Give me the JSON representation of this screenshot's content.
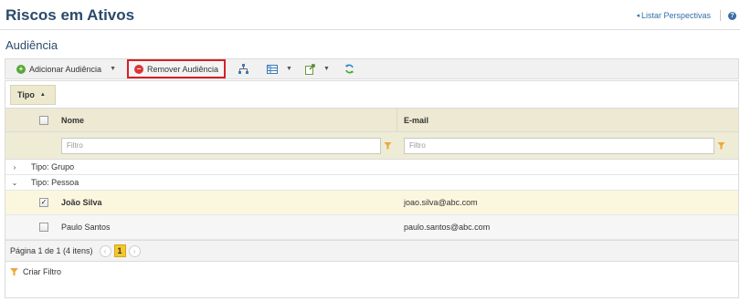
{
  "page": {
    "title": "Riscos em Ativos"
  },
  "top_links": {
    "list_perspectives": "Listar Perspectivas",
    "help_icon": "?"
  },
  "section": {
    "title": "Audiência"
  },
  "toolbar": {
    "add_label": "Adicionar Audiência",
    "remove_label": "Remover Audiência",
    "icons": [
      "hierarchy-icon",
      "columns-icon",
      "export-icon",
      "refresh-icon"
    ]
  },
  "grouping": {
    "chip_label": "Tipo"
  },
  "columns": {
    "name": "Nome",
    "email": "E-mail"
  },
  "filters": {
    "name_placeholder": "Filtro",
    "email_placeholder": "Filtro"
  },
  "groups": [
    {
      "label": "Tipo: Grupo",
      "expanded": false
    },
    {
      "label": "Tipo: Pessoa",
      "expanded": true
    }
  ],
  "rows": [
    {
      "name": "João Silva",
      "email": "joao.silva@abc.com",
      "checked": true
    },
    {
      "name": "Paulo Santos",
      "email": "paulo.santos@abc.com",
      "checked": false
    }
  ],
  "pager": {
    "info": "Página 1 de 1 (4 itens)",
    "current_page": "1"
  },
  "footer": {
    "create_filter": "Criar Filtro"
  },
  "colors": {
    "accent_title": "#2a4a6b",
    "highlight_border": "#d61f26",
    "selected_row": "#fbf7df",
    "page_active": "#f3c82d"
  }
}
